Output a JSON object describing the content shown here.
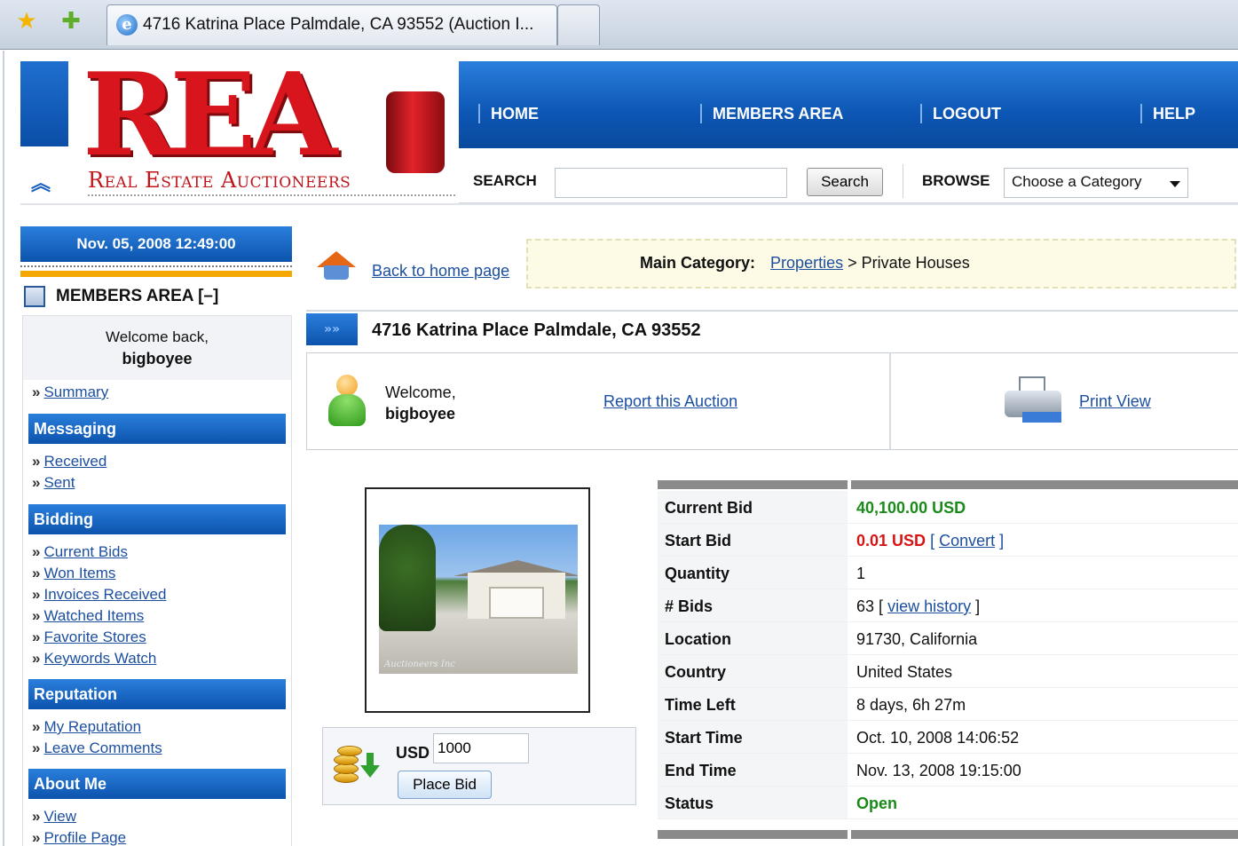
{
  "browser": {
    "tab_title": "4716 Katrina Place Palmdale, CA 93552 (Auction I...",
    "favorites_icon": "star-icon",
    "add_favorites_icon": "add-star-icon",
    "tab_icon": "ie-icon"
  },
  "logo": {
    "big": "REA",
    "sub": "Real Estate Auctioneers"
  },
  "nav": {
    "items": [
      {
        "label": "HOME"
      },
      {
        "label": "MEMBERS AREA"
      },
      {
        "label": "LOGOUT"
      },
      {
        "label": "HELP"
      }
    ]
  },
  "search": {
    "label": "SEARCH",
    "value": "",
    "button": "Search",
    "browse_label": "BROWSE",
    "category_selected": "Choose a Category"
  },
  "sidebar": {
    "date": "Nov. 05, 2008 12:49:00",
    "members_title": "MEMBERS AREA [–]",
    "welcome_text": "Welcome back,",
    "username": "bigboyee",
    "summary": "Summary",
    "sections": [
      {
        "title": "Messaging",
        "links": [
          "Received",
          "Sent"
        ]
      },
      {
        "title": "Bidding",
        "links": [
          "Current Bids",
          "Won Items",
          "Invoices Received",
          "Watched Items",
          "Favorite Stores",
          "Keywords Watch"
        ]
      },
      {
        "title": "Reputation",
        "links": [
          "My Reputation",
          "Leave Comments"
        ]
      },
      {
        "title": "About Me",
        "links": [
          "View",
          "Profile Page"
        ]
      }
    ],
    "bullet": "»"
  },
  "main": {
    "back_link": "Back to home page",
    "main_category_label": "Main Category:",
    "category_link": "Properties",
    "category_sep": ">",
    "subcategory": "Private Houses",
    "title": "4716 Katrina Place Palmdale, CA 93552",
    "title_arrow": "»»",
    "welcome": "Welcome,",
    "username": "bigboyee",
    "report_link": "Report this Auction",
    "print_link": "Print View",
    "photo_watermark": "Auctioneers Inc"
  },
  "bid": {
    "currency": "USD",
    "amount": "1000",
    "button": "Place Bid"
  },
  "details": {
    "rows": [
      {
        "label": "Current Bid",
        "value": "40,100.00 USD"
      },
      {
        "label": "Start Bid",
        "value": "0.01 USD",
        "extra_link": "Convert"
      },
      {
        "label": "Quantity",
        "value": "1"
      },
      {
        "label": "# Bids",
        "value": "63",
        "extra_link": "view history"
      },
      {
        "label": "Location",
        "value": "91730, California"
      },
      {
        "label": "Country",
        "value": "United States"
      },
      {
        "label": "Time Left",
        "value": "8 days, 6h 27m"
      },
      {
        "label": "Start Time",
        "value": "Oct. 10, 2008 14:06:52"
      },
      {
        "label": "End Time",
        "value": "Nov. 13, 2008 19:15:00"
      },
      {
        "label": "Status",
        "value": "Open"
      }
    ]
  },
  "colors": {
    "nav_blue": "#0d56b4",
    "logo_red": "#d8141c",
    "link_blue": "#1c4fa0",
    "accent_orange": "#f5a800",
    "value_green": "#1a8a1a",
    "value_red": "#d81414"
  }
}
